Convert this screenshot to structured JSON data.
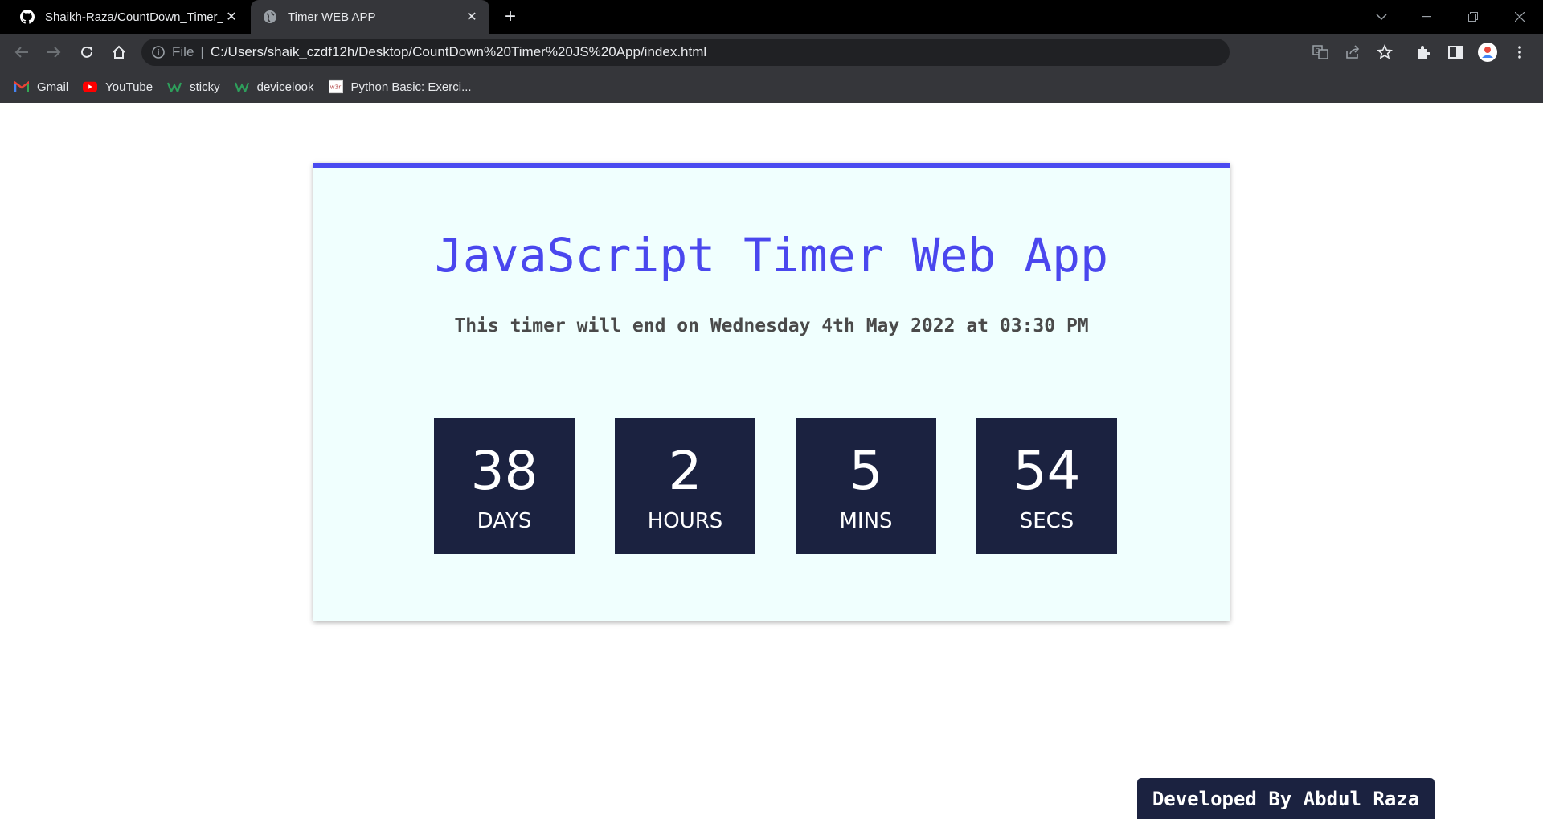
{
  "browser": {
    "tabs": [
      {
        "title": "Shaikh-Raza/CountDown_Timer_",
        "active": false,
        "icon": "github-icon"
      },
      {
        "title": "Timer WEB APP",
        "active": true,
        "icon": "globe-icon"
      }
    ],
    "omnibox": {
      "scheme_label": "File",
      "url": "C:/Users/shaik_czdf12h/Desktop/CountDown%20Timer%20JS%20App/index.html"
    },
    "bookmarks": [
      {
        "label": "Gmail",
        "icon": "gmail-icon"
      },
      {
        "label": "YouTube",
        "icon": "youtube-icon"
      },
      {
        "label": "sticky",
        "icon": "w-icon"
      },
      {
        "label": "devicelook",
        "icon": "w-icon"
      },
      {
        "label": "Python Basic: Exerci...",
        "icon": "w3r-icon"
      }
    ]
  },
  "page": {
    "title": "JavaScript Timer Web App",
    "subtitle": "This timer will end on Wednesday 4th May 2022 at 03:30 PM",
    "timer": [
      {
        "value": "38",
        "label": "DAYS"
      },
      {
        "value": "2",
        "label": "HOURS"
      },
      {
        "value": "5",
        "label": "MINS"
      },
      {
        "value": "54",
        "label": "SECS"
      }
    ],
    "footer": "Developed By Abdul Raza"
  },
  "colors": {
    "accent": "#4a47ee",
    "box_bg": "#1b2240",
    "card_bg": "#f0fffe"
  }
}
